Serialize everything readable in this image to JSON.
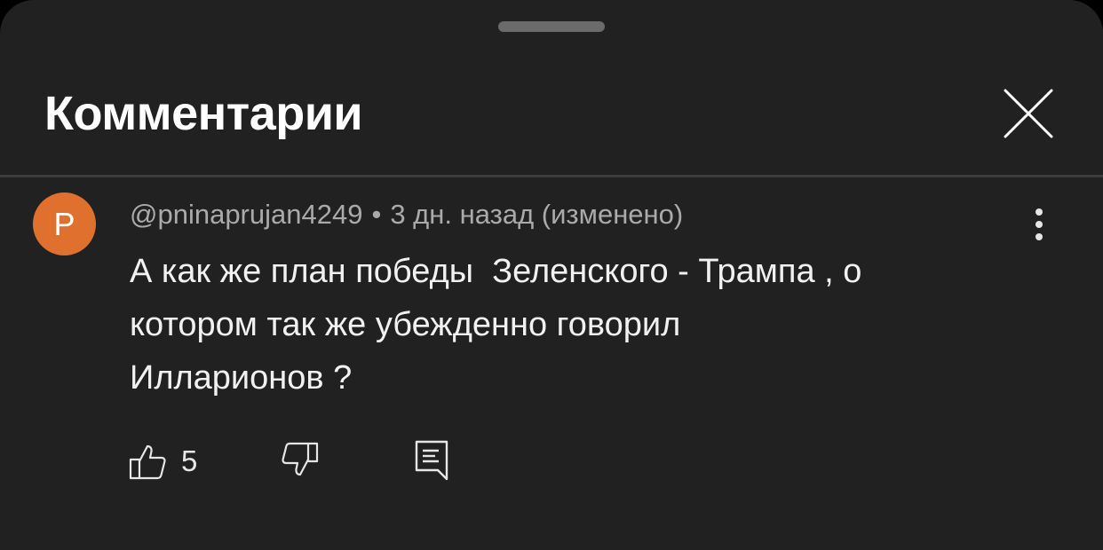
{
  "panel": {
    "title": "Комментарии"
  },
  "comment": {
    "avatar_letter": "P",
    "author": "@pninaprujan4249",
    "separator": "•",
    "time": "3 дн. назад (изменено)",
    "text": "А как же план победы  Зеленского - Трампа , о\nкотором так же убежденно говорил\nИлларионов ?",
    "likes": "5"
  },
  "icons": {
    "close": "close-icon",
    "more": "more-vertical-icon",
    "like": "thumb-up-icon",
    "dislike": "thumb-down-icon",
    "reply": "reply-comment-icon"
  },
  "colors": {
    "background": "#212121",
    "avatar": "#e0702e",
    "meta_text": "#aaaaaa",
    "body_text": "#f1f1f1"
  }
}
